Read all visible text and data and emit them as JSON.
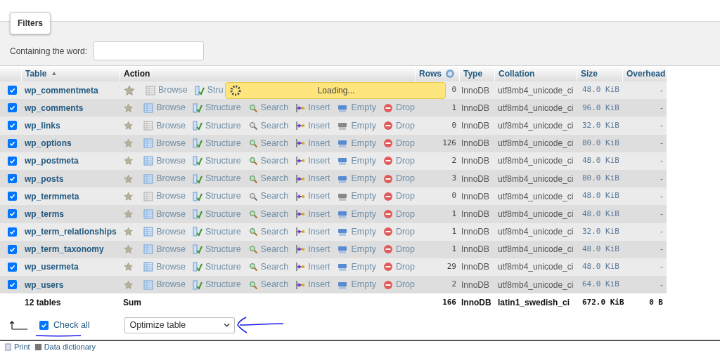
{
  "filters": {
    "legend": "Filters",
    "label": "Containing the word:"
  },
  "table": {
    "columns": [
      {
        "label": "Table",
        "sort": "▲"
      },
      {
        "label": "Action"
      },
      {
        "label": "Rows"
      },
      {
        "label": "Type"
      },
      {
        "label": "Collation"
      },
      {
        "label": "Size"
      },
      {
        "label": "Overhead"
      }
    ],
    "rows": [
      {
        "name": "wp_commentmeta",
        "checked": true,
        "empty": true,
        "actions": [
          {
            "kind": "browse",
            "label": "Browse"
          },
          {
            "kind": "structure",
            "label": "Stru"
          }
        ],
        "rows": "0",
        "type": "InnoDB",
        "collation": "utf8mb4_unicode_ci",
        "size": "48.0 KiB",
        "overhead": "-"
      },
      {
        "name": "wp_comments",
        "checked": true,
        "empty": false,
        "actions": [
          {
            "kind": "browse",
            "label": "Browse"
          },
          {
            "kind": "structure",
            "label": "Structure"
          },
          {
            "kind": "search",
            "label": "Search"
          },
          {
            "kind": "insert",
            "label": "Insert"
          },
          {
            "kind": "empty",
            "label": "Empty"
          },
          {
            "kind": "drop",
            "label": "Drop"
          }
        ],
        "rows": "1",
        "type": "InnoDB",
        "collation": "utf8mb4_unicode_ci",
        "size": "96.0 KiB",
        "overhead": "-"
      },
      {
        "name": "wp_links",
        "checked": true,
        "empty": true,
        "actions": [
          {
            "kind": "browse",
            "label": "Browse"
          },
          {
            "kind": "structure",
            "label": "Structure"
          },
          {
            "kind": "search",
            "label": "Search"
          },
          {
            "kind": "insert",
            "label": "Insert"
          },
          {
            "kind": "empty",
            "label": "Empty"
          },
          {
            "kind": "drop",
            "label": "Drop"
          }
        ],
        "rows": "0",
        "type": "InnoDB",
        "collation": "utf8mb4_unicode_ci",
        "size": "32.0 KiB",
        "overhead": "-"
      },
      {
        "name": "wp_options",
        "checked": true,
        "empty": false,
        "actions": [
          {
            "kind": "browse",
            "label": "Browse"
          },
          {
            "kind": "structure",
            "label": "Structure"
          },
          {
            "kind": "search",
            "label": "Search"
          },
          {
            "kind": "insert",
            "label": "Insert"
          },
          {
            "kind": "empty",
            "label": "Empty"
          },
          {
            "kind": "drop",
            "label": "Drop"
          }
        ],
        "rows": "126",
        "type": "InnoDB",
        "collation": "utf8mb4_unicode_ci",
        "size": "80.0 KiB",
        "overhead": "-"
      },
      {
        "name": "wp_postmeta",
        "checked": true,
        "empty": false,
        "actions": [
          {
            "kind": "browse",
            "label": "Browse"
          },
          {
            "kind": "structure",
            "label": "Structure"
          },
          {
            "kind": "search",
            "label": "Search"
          },
          {
            "kind": "insert",
            "label": "Insert"
          },
          {
            "kind": "empty",
            "label": "Empty"
          },
          {
            "kind": "drop",
            "label": "Drop"
          }
        ],
        "rows": "2",
        "type": "InnoDB",
        "collation": "utf8mb4_unicode_ci",
        "size": "48.0 KiB",
        "overhead": "-"
      },
      {
        "name": "wp_posts",
        "checked": true,
        "empty": false,
        "actions": [
          {
            "kind": "browse",
            "label": "Browse"
          },
          {
            "kind": "structure",
            "label": "Structure"
          },
          {
            "kind": "search",
            "label": "Search"
          },
          {
            "kind": "insert",
            "label": "Insert"
          },
          {
            "kind": "empty",
            "label": "Empty"
          },
          {
            "kind": "drop",
            "label": "Drop"
          }
        ],
        "rows": "3",
        "type": "InnoDB",
        "collation": "utf8mb4_unicode_ci",
        "size": "80.0 KiB",
        "overhead": "-"
      },
      {
        "name": "wp_termmeta",
        "checked": true,
        "empty": true,
        "actions": [
          {
            "kind": "browse",
            "label": "Browse"
          },
          {
            "kind": "structure",
            "label": "Structure"
          },
          {
            "kind": "search",
            "label": "Search"
          },
          {
            "kind": "insert",
            "label": "Insert"
          },
          {
            "kind": "empty",
            "label": "Empty"
          },
          {
            "kind": "drop",
            "label": "Drop"
          }
        ],
        "rows": "0",
        "type": "InnoDB",
        "collation": "utf8mb4_unicode_ci",
        "size": "48.0 KiB",
        "overhead": "-"
      },
      {
        "name": "wp_terms",
        "checked": true,
        "empty": false,
        "actions": [
          {
            "kind": "browse",
            "label": "Browse"
          },
          {
            "kind": "structure",
            "label": "Structure"
          },
          {
            "kind": "search",
            "label": "Search"
          },
          {
            "kind": "insert",
            "label": "Insert"
          },
          {
            "kind": "empty",
            "label": "Empty"
          },
          {
            "kind": "drop",
            "label": "Drop"
          }
        ],
        "rows": "1",
        "type": "InnoDB",
        "collation": "utf8mb4_unicode_ci",
        "size": "48.0 KiB",
        "overhead": "-"
      },
      {
        "name": "wp_term_relationships",
        "checked": true,
        "empty": false,
        "actions": [
          {
            "kind": "browse",
            "label": "Browse"
          },
          {
            "kind": "structure",
            "label": "Structure"
          },
          {
            "kind": "search",
            "label": "Search"
          },
          {
            "kind": "insert",
            "label": "Insert"
          },
          {
            "kind": "empty",
            "label": "Empty"
          },
          {
            "kind": "drop",
            "label": "Drop"
          }
        ],
        "rows": "1",
        "type": "InnoDB",
        "collation": "utf8mb4_unicode_ci",
        "size": "32.0 KiB",
        "overhead": "-"
      },
      {
        "name": "wp_term_taxonomy",
        "checked": true,
        "empty": false,
        "actions": [
          {
            "kind": "browse",
            "label": "Browse"
          },
          {
            "kind": "structure",
            "label": "Structure"
          },
          {
            "kind": "search",
            "label": "Search"
          },
          {
            "kind": "insert",
            "label": "Insert"
          },
          {
            "kind": "empty",
            "label": "Empty"
          },
          {
            "kind": "drop",
            "label": "Drop"
          }
        ],
        "rows": "1",
        "type": "InnoDB",
        "collation": "utf8mb4_unicode_ci",
        "size": "48.0 KiB",
        "overhead": "-"
      },
      {
        "name": "wp_usermeta",
        "checked": true,
        "empty": false,
        "actions": [
          {
            "kind": "browse",
            "label": "Browse"
          },
          {
            "kind": "structure",
            "label": "Structure"
          },
          {
            "kind": "search",
            "label": "Search"
          },
          {
            "kind": "insert",
            "label": "Insert"
          },
          {
            "kind": "empty",
            "label": "Empty"
          },
          {
            "kind": "drop",
            "label": "Drop"
          }
        ],
        "rows": "29",
        "type": "InnoDB",
        "collation": "utf8mb4_unicode_ci",
        "size": "48.0 KiB",
        "overhead": "-"
      },
      {
        "name": "wp_users",
        "checked": true,
        "empty": false,
        "actions": [
          {
            "kind": "browse",
            "label": "Browse"
          },
          {
            "kind": "structure",
            "label": "Structure"
          },
          {
            "kind": "search",
            "label": "Search"
          },
          {
            "kind": "insert",
            "label": "Insert"
          },
          {
            "kind": "empty",
            "label": "Empty"
          },
          {
            "kind": "drop",
            "label": "Drop"
          }
        ],
        "rows": "2",
        "type": "InnoDB",
        "collation": "utf8mb4_unicode_ci",
        "size": "64.0 KiB",
        "overhead": "-"
      }
    ],
    "summary": {
      "tables": "12 tables",
      "label": "Sum",
      "rows": "166",
      "type": "InnoDB",
      "collation": "latin1_swedish_ci",
      "size": "672.0 KiB",
      "overhead": "0 B"
    }
  },
  "loading": {
    "text": "Loading..."
  },
  "bulk": {
    "check_all": {
      "label": "Check all",
      "checked": true
    },
    "select": "Optimize table"
  },
  "footer_links": [
    "Print",
    "Data dictionary"
  ]
}
